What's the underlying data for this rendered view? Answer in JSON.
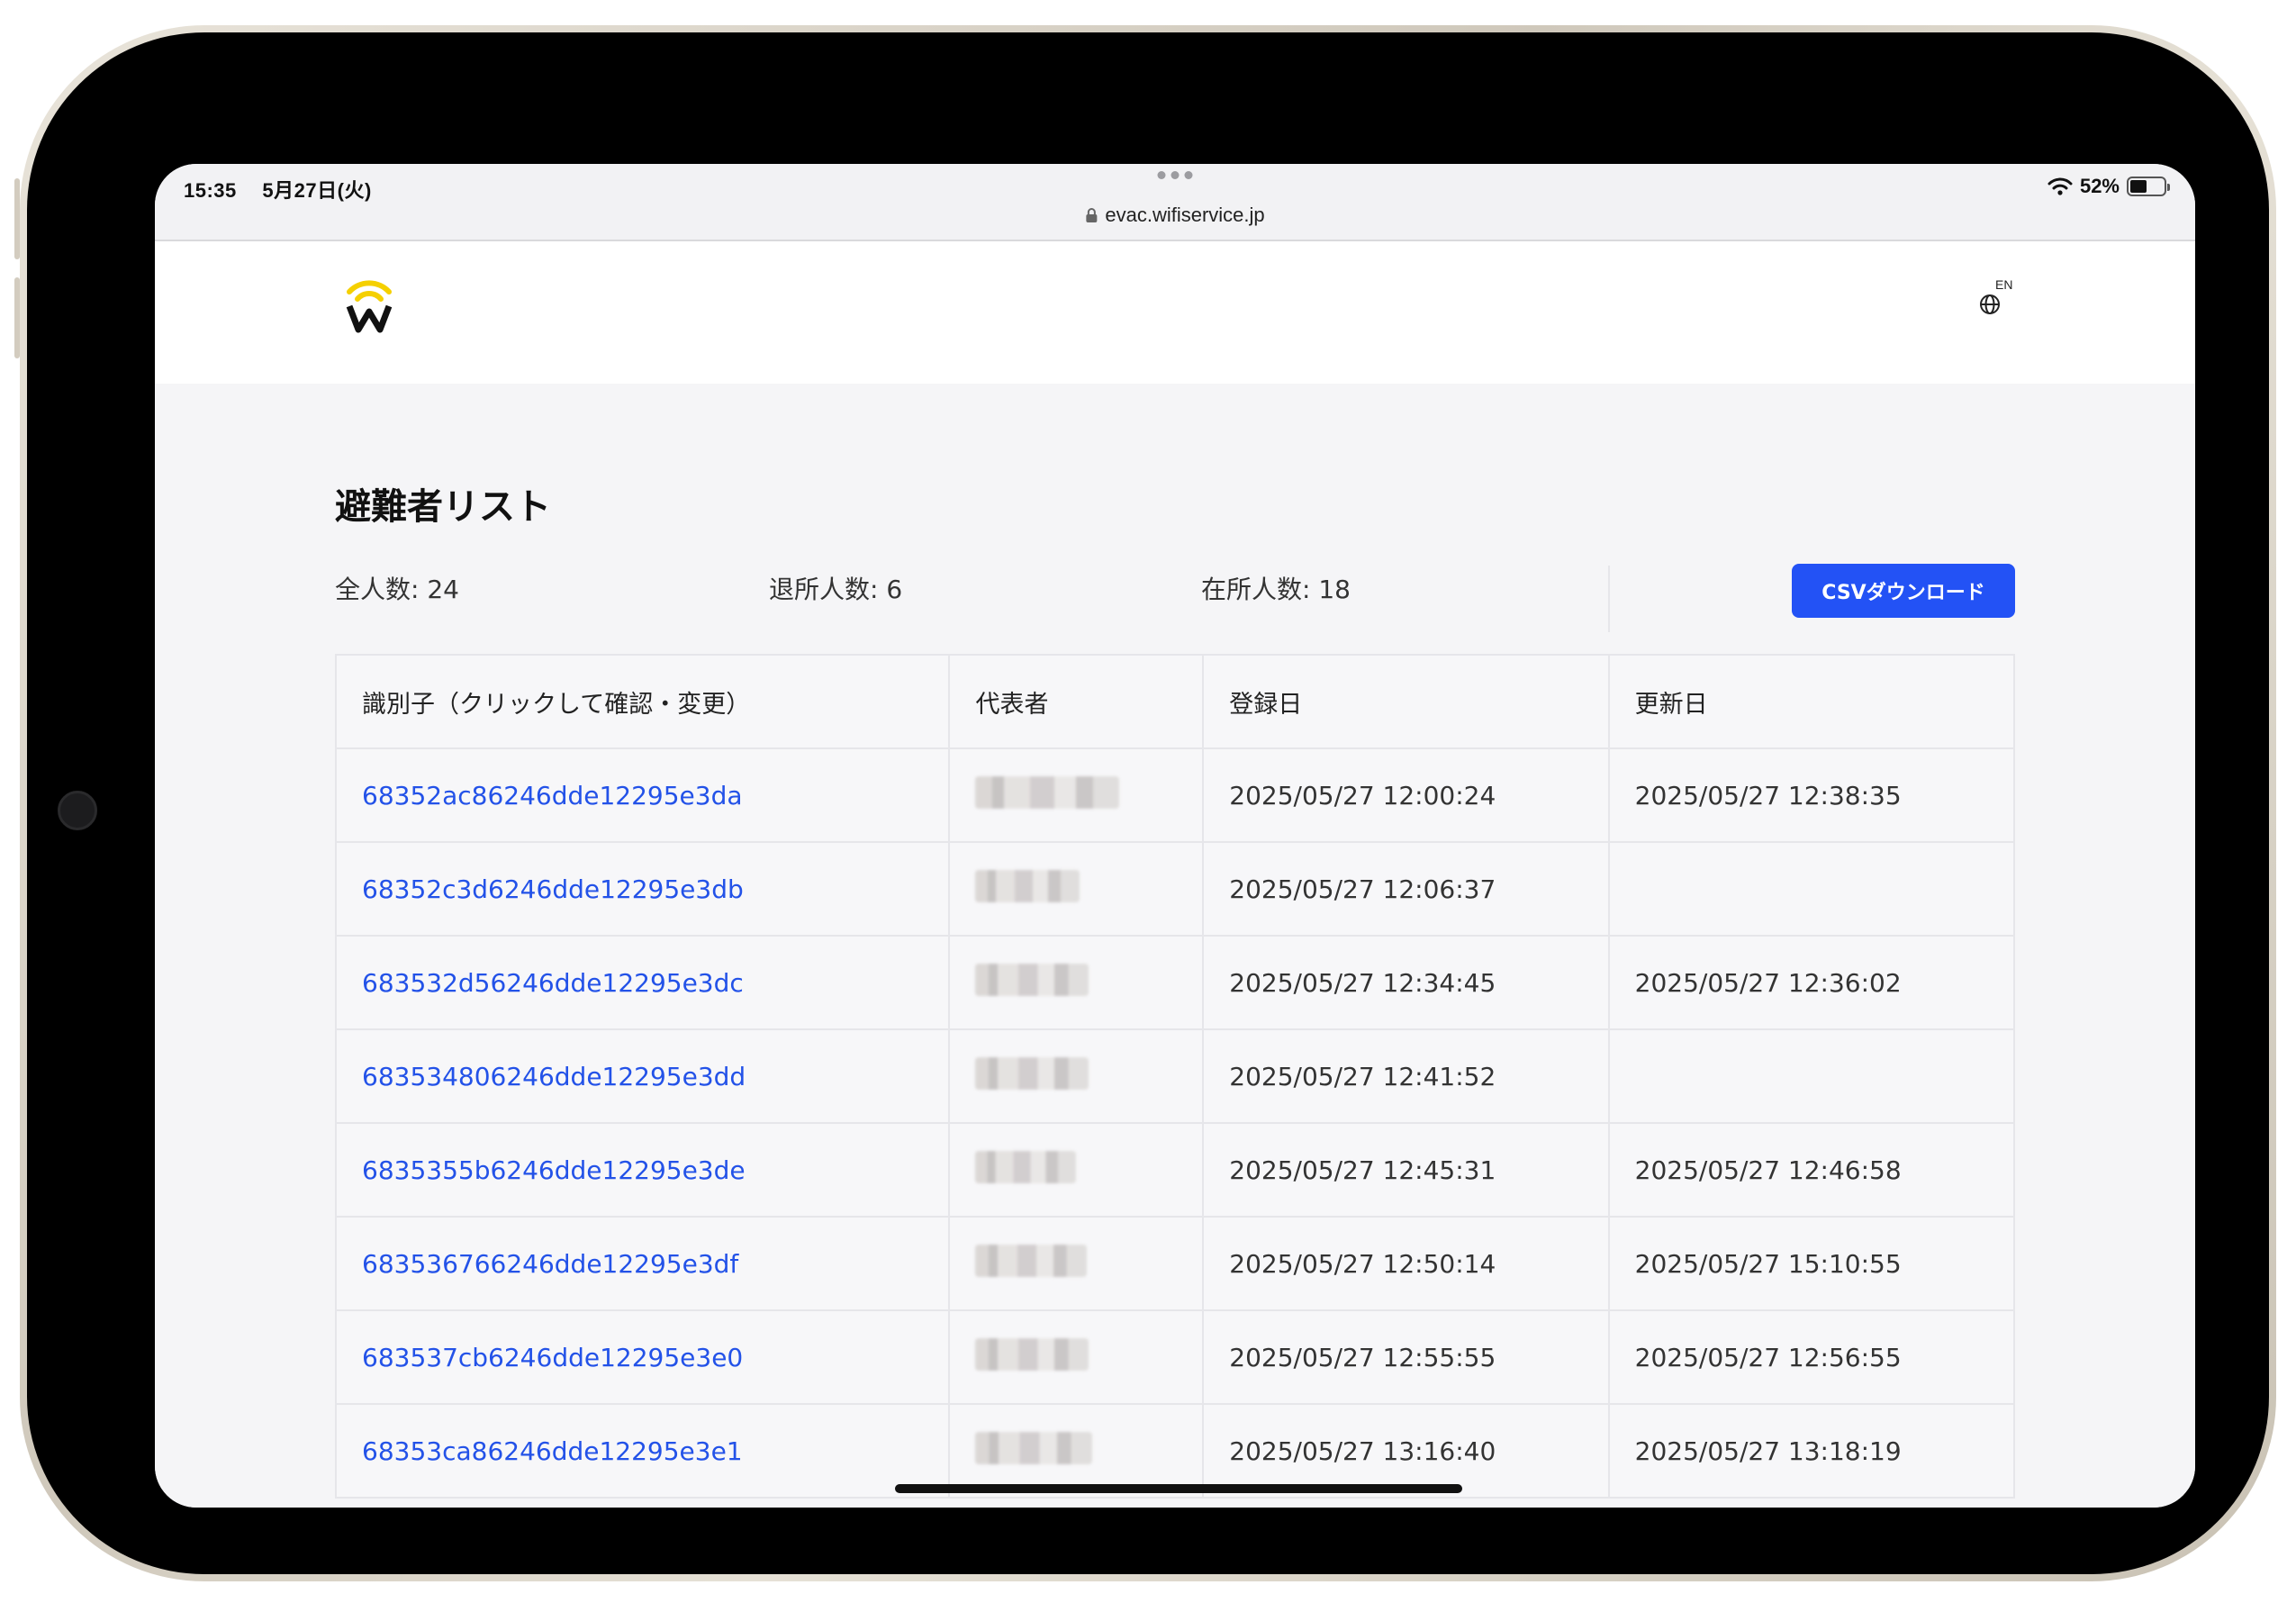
{
  "status_bar": {
    "time": "15:35",
    "date": "5月27日(火)",
    "battery": "52%",
    "url": "evac.wifiservice.jp"
  },
  "header": {
    "logo_letter": "W",
    "lang_label": "EN"
  },
  "page": {
    "title": "避難者リスト",
    "stats": {
      "total": "全人数: 24",
      "left": "退所人数: 6",
      "present": "在所人数: 18"
    },
    "csv_button": "CSVダウンロード"
  },
  "table": {
    "headers": [
      "識別子（クリックして確認・変更）",
      "代表者",
      "登録日",
      "更新日"
    ],
    "rows": [
      {
        "id": "68352ac86246dde12295e3da",
        "registered": "2025/05/27 12:00:24",
        "updated": "2025/05/27 12:38:35"
      },
      {
        "id": "68352c3d6246dde12295e3db",
        "registered": "2025/05/27 12:06:37",
        "updated": ""
      },
      {
        "id": "683532d56246dde12295e3dc",
        "registered": "2025/05/27 12:34:45",
        "updated": "2025/05/27 12:36:02"
      },
      {
        "id": "683534806246dde12295e3dd",
        "registered": "2025/05/27 12:41:52",
        "updated": ""
      },
      {
        "id": "6835355b6246dde12295e3de",
        "registered": "2025/05/27 12:45:31",
        "updated": "2025/05/27 12:46:58"
      },
      {
        "id": "683536766246dde12295e3df",
        "registered": "2025/05/27 12:50:14",
        "updated": "2025/05/27 15:10:55"
      },
      {
        "id": "683537cb6246dde12295e3e0",
        "registered": "2025/05/27 12:55:55",
        "updated": "2025/05/27 12:56:55"
      },
      {
        "id": "68353ca86246dde12295e3e1",
        "registered": "2025/05/27 13:16:40",
        "updated": "2025/05/27 13:18:19"
      }
    ]
  },
  "colors": {
    "accent": "#2352f5",
    "logo_yellow": "#f5d000"
  }
}
